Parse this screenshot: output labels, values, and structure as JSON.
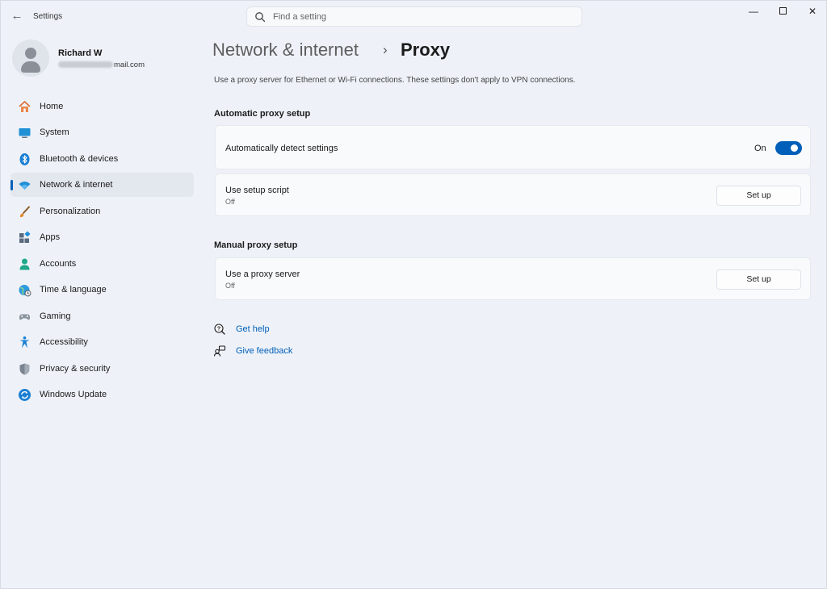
{
  "window": {
    "app_title": "Settings",
    "search_placeholder": "Find a setting",
    "controls": {
      "minimize": "—",
      "close": "✕"
    }
  },
  "profile": {
    "name": "Richard W",
    "email_visible": "mail.com"
  },
  "sidebar": {
    "items": [
      {
        "label": "Home",
        "icon": "home-icon"
      },
      {
        "label": "System",
        "icon": "system-icon"
      },
      {
        "label": "Bluetooth & devices",
        "icon": "bluetooth-icon"
      },
      {
        "label": "Network & internet",
        "icon": "wifi-icon",
        "active": true
      },
      {
        "label": "Personalization",
        "icon": "brush-icon"
      },
      {
        "label": "Apps",
        "icon": "apps-icon"
      },
      {
        "label": "Accounts",
        "icon": "accounts-icon"
      },
      {
        "label": "Time & language",
        "icon": "globe-clock-icon"
      },
      {
        "label": "Gaming",
        "icon": "gamepad-icon"
      },
      {
        "label": "Accessibility",
        "icon": "accessibility-icon"
      },
      {
        "label": "Privacy & security",
        "icon": "shield-icon"
      },
      {
        "label": "Windows Update",
        "icon": "update-icon"
      }
    ]
  },
  "main": {
    "breadcrumb_parent": "Network & internet",
    "breadcrumb_separator": "›",
    "breadcrumb_current": "Proxy",
    "description": "Use a proxy server for Ethernet or Wi-Fi connections. These settings don't apply to VPN connections.",
    "automatic": {
      "section_title": "Automatic proxy setup",
      "detect": {
        "title": "Automatically detect settings",
        "state_label": "On",
        "enabled": true
      },
      "script": {
        "title": "Use setup script",
        "status": "Off",
        "button": "Set up"
      }
    },
    "manual": {
      "section_title": "Manual proxy setup",
      "proxy": {
        "title": "Use a proxy server",
        "status": "Off",
        "button": "Set up"
      }
    },
    "links": {
      "help": "Get help",
      "feedback": "Give feedback"
    }
  },
  "colors": {
    "accent": "#005fb8",
    "background": "#eef2f8",
    "card": "#f9fafc"
  }
}
